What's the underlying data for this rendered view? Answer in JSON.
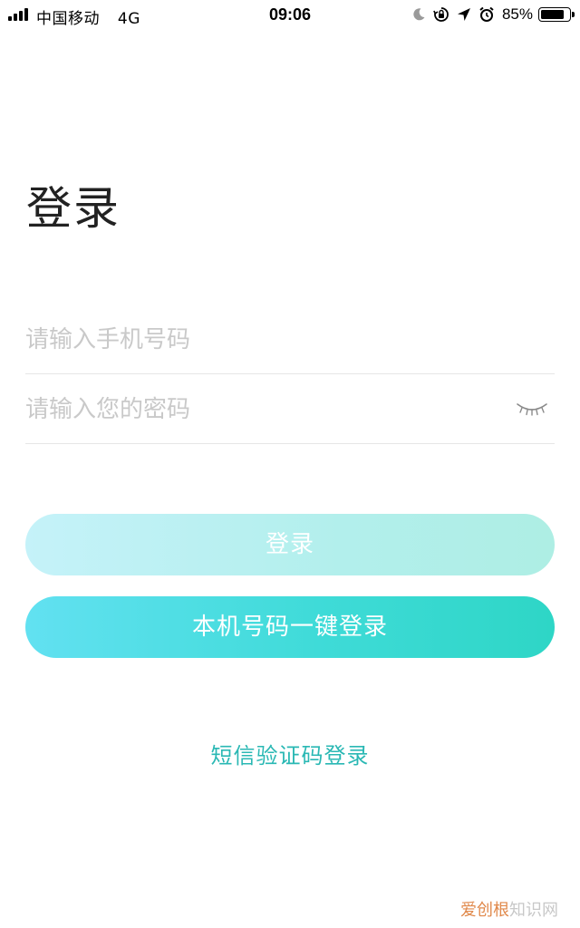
{
  "status_bar": {
    "carrier": "中国移动",
    "network": "4G",
    "time": "09:06",
    "battery_percent": "85%",
    "battery_level": 0.85,
    "icons": [
      "moon-icon",
      "rotation-lock-icon",
      "location-arrow-icon",
      "alarm-icon"
    ]
  },
  "page": {
    "title": "登录"
  },
  "form": {
    "phone_placeholder": "请输入手机号码",
    "password_placeholder": "请输入您的密码",
    "password_visibility_icon": "eye-closed-icon"
  },
  "buttons": {
    "login_label": "登录",
    "one_key_login_label": "本机号码一键登录"
  },
  "links": {
    "sms_login_label": "短信验证码登录"
  },
  "watermark": {
    "accent": "爱创根",
    "rest": "知识网"
  },
  "colors": {
    "title_text": "#222222",
    "placeholder_text": "#c9c9c9",
    "login_button_disabled": "#b8f0ef",
    "one_key_button_start": "#62e1f1",
    "one_key_button_end": "#2ed6c6",
    "link_text": "#2ab8b4"
  }
}
